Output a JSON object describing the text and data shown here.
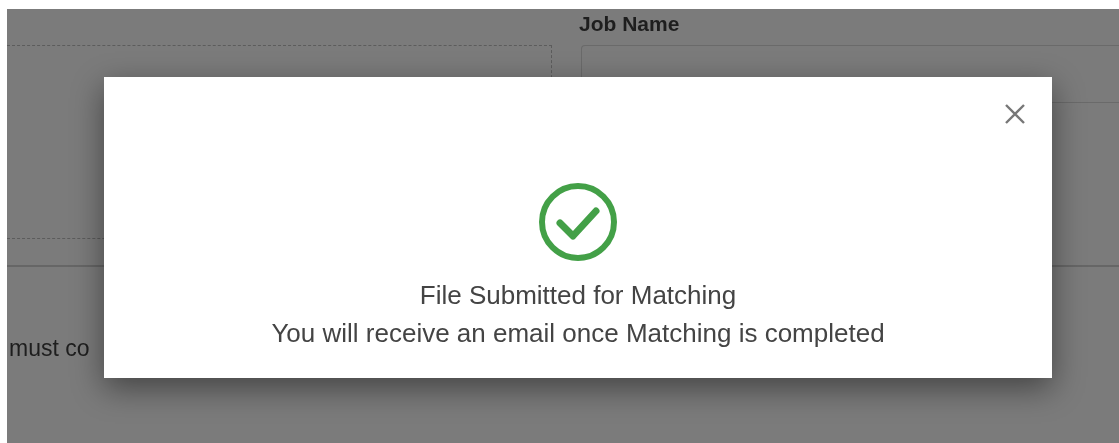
{
  "background_form": {
    "field_label": "Job Name",
    "partial_text": "must co"
  },
  "dialog": {
    "title": "File Submitted for Matching",
    "message": "You will receive an email once Matching is completed"
  }
}
